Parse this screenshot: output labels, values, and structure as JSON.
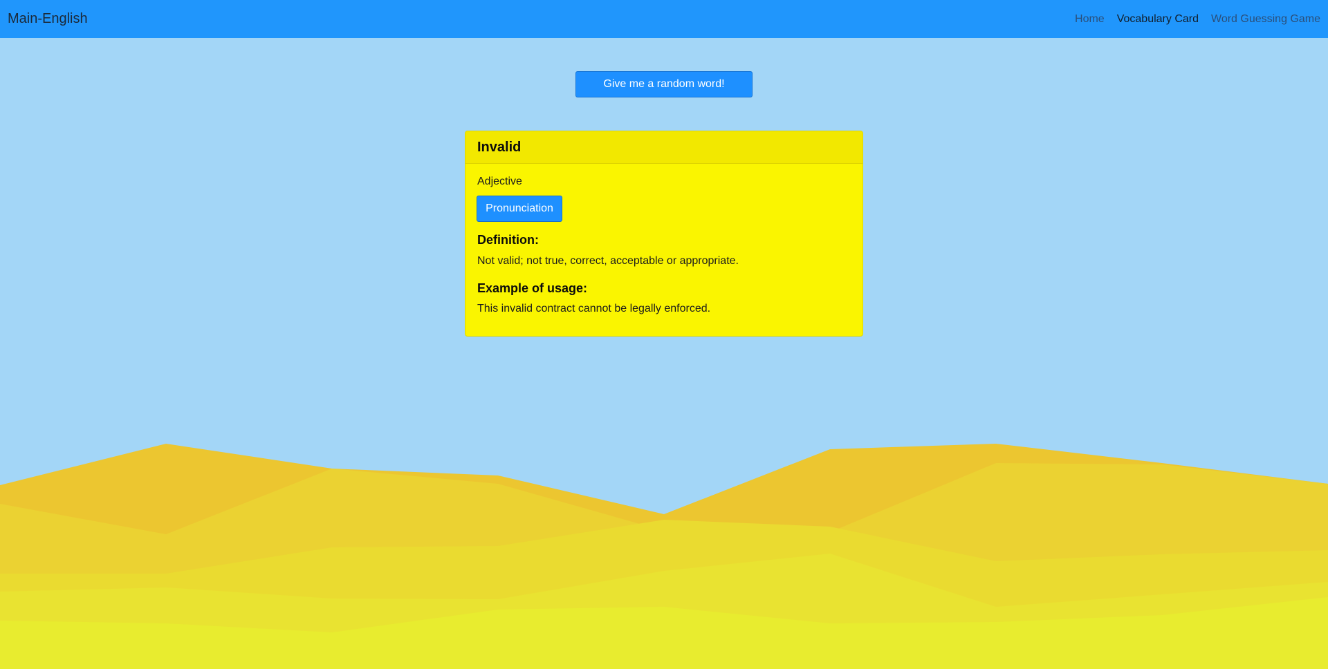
{
  "navbar": {
    "brand": "Main-English",
    "links": [
      {
        "label": "Home",
        "active": false
      },
      {
        "label": "Vocabulary Card",
        "active": true
      },
      {
        "label": "Word Guessing Game",
        "active": false
      }
    ],
    "background_color": "#2096fc"
  },
  "random_button": {
    "label": "Give me a random word!"
  },
  "card": {
    "word": "Invalid",
    "part_of_speech": "Adjective",
    "pronunciation_label": "Pronunciation",
    "definition_heading": "Definition:",
    "definition": "Not valid; not true, correct, acceptable or appropriate.",
    "example_heading": "Example of usage:",
    "example": "This invalid contract cannot be legally enforced.",
    "background_color": "#faf500"
  },
  "colors": {
    "page_background": "#a3d6f7",
    "button_blue": "#1e90ff",
    "dune_colors": [
      "#ecc630",
      "#ebd232",
      "#eadb30",
      "#e9e331",
      "#e8ec2f"
    ]
  }
}
